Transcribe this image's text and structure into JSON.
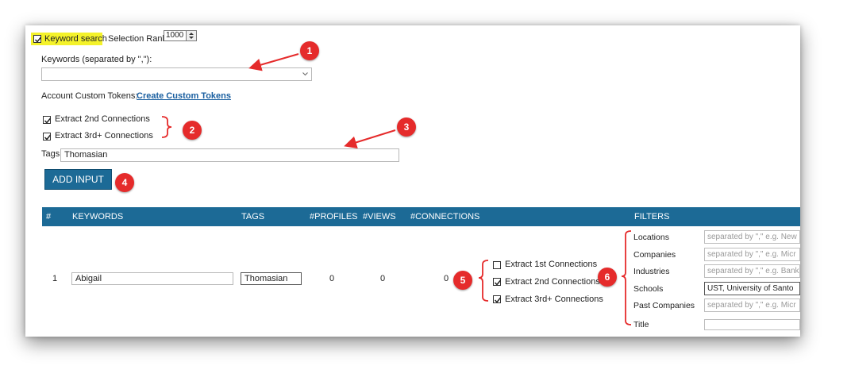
{
  "top": {
    "keyword_search_label": "Keyword search",
    "keyword_search_checked": true,
    "selection_rank_label": "Selection Rank",
    "selection_rank_value": "1000",
    "keywords_label": "Keywords (separated by \",\"):",
    "keywords_value": "",
    "tokens_label": "Account Custom Tokens:",
    "tokens_link": "Create Custom Tokens",
    "extract_2nd_label": "Extract 2nd Connections",
    "extract_3rd_label": "Extract 3rd+ Connections",
    "tags_label": "Tags",
    "tags_value": "Thomasian",
    "add_input_label": "ADD INPUT"
  },
  "table": {
    "headers": [
      "#",
      "KEYWORDS",
      "TAGS",
      "#PROFILES",
      "#VIEWS",
      "#CONNECTIONS",
      "FILTERS"
    ],
    "row": {
      "index": "1",
      "keywords": "Abigail",
      "tags": "Thomasian",
      "profiles": "0",
      "views": "0",
      "connections": "0",
      "extract_options": [
        {
          "label": "Extract 1st Connections",
          "checked": false
        },
        {
          "label": "Extract 2nd Connections",
          "checked": true
        },
        {
          "label": "Extract 3rd+ Connections",
          "checked": true
        }
      ],
      "filters": [
        {
          "label": "Locations",
          "placeholder": "separated by \",\" e.g. New",
          "value": ""
        },
        {
          "label": "Companies",
          "placeholder": "separated by \",\" e.g. Micr",
          "value": ""
        },
        {
          "label": "Industries",
          "placeholder": "separated by \",\" e.g. Bank",
          "value": ""
        },
        {
          "label": "Schools",
          "placeholder": "",
          "value": "UST, University of Santo"
        },
        {
          "label": "Past Companies",
          "placeholder": "separated by \",\" e.g. Micr",
          "value": ""
        },
        {
          "label": "Title",
          "placeholder": "",
          "value": ""
        }
      ]
    }
  },
  "annotations": [
    "1",
    "2",
    "3",
    "4",
    "5",
    "6"
  ],
  "colors": {
    "header": "#1c6a96",
    "badge": "#e52b2b",
    "highlight": "#f4f22a",
    "link": "#1a5fa0"
  }
}
